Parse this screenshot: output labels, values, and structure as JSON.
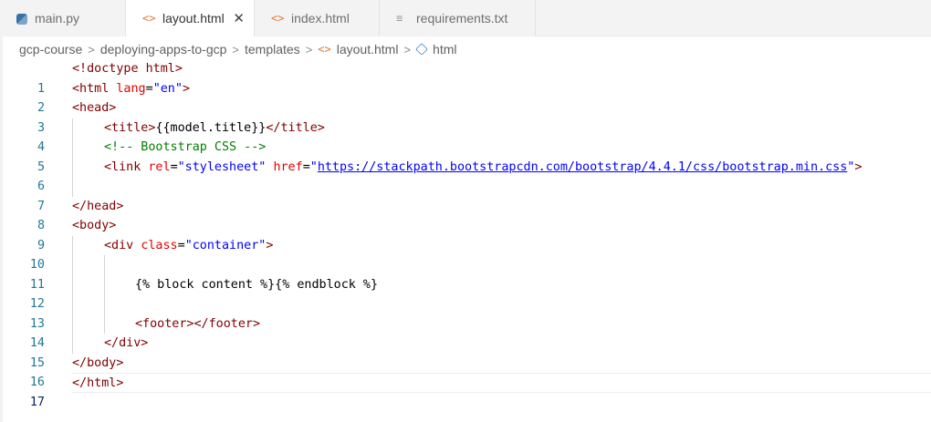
{
  "tabs": [
    {
      "label": "main.py",
      "icon": "python-file-icon",
      "active": false
    },
    {
      "label": "layout.html",
      "icon": "html-file-icon",
      "active": true,
      "close": "✕"
    },
    {
      "label": "index.html",
      "icon": "html-file-icon",
      "active": false
    },
    {
      "label": "requirements.txt",
      "icon": "text-file-icon",
      "active": false
    }
  ],
  "breadcrumb": {
    "items": [
      "gcp-course",
      "deploying-apps-to-gcp",
      "templates",
      "layout.html",
      "html"
    ],
    "separator": ">"
  },
  "editor": {
    "current_line": "17",
    "lines": [
      {
        "n": "1"
      },
      {
        "n": "2"
      },
      {
        "n": "3"
      },
      {
        "n": "4"
      },
      {
        "n": "5"
      },
      {
        "n": "6"
      },
      {
        "n": "7"
      },
      {
        "n": "8"
      },
      {
        "n": "9"
      },
      {
        "n": "10"
      },
      {
        "n": "11"
      },
      {
        "n": "12"
      },
      {
        "n": "13"
      },
      {
        "n": "14"
      },
      {
        "n": "15"
      },
      {
        "n": "16"
      },
      {
        "n": "17"
      }
    ],
    "tokens": {
      "l1": [
        "<!doctype html>"
      ],
      "l2": [
        "<html ",
        "lang",
        "=",
        "\"en\"",
        ">"
      ],
      "l3": [
        "<head>"
      ],
      "l4": [
        "<title>",
        "{{model.title}}",
        "</title>"
      ],
      "l5": [
        "<!-- Bootstrap CSS -->"
      ],
      "l6": [
        "<link ",
        "rel",
        "=",
        "\"stylesheet\"",
        " ",
        "href",
        "=",
        "\"",
        "https://stackpath.bootstrapcdn.com/bootstrap/4.4.1/css/bootstrap.min.css",
        "\"",
        ">"
      ],
      "l8": [
        "</head>"
      ],
      "l9": [
        "<body>"
      ],
      "l10": [
        "<div ",
        "class",
        "=",
        "\"container\"",
        ">"
      ],
      "l12": [
        "{% block content %}{% endblock %}"
      ],
      "l14": [
        "<footer></footer>"
      ],
      "l15": [
        "</div>"
      ],
      "l16": [
        "</body>"
      ],
      "l17": [
        "</html>"
      ]
    }
  },
  "colors": {
    "tag": "#800000",
    "attribute": "#e50000",
    "string": "#0000ff",
    "comment": "#008000",
    "line_number": "#237893",
    "current_line_number": "#0b216f"
  }
}
